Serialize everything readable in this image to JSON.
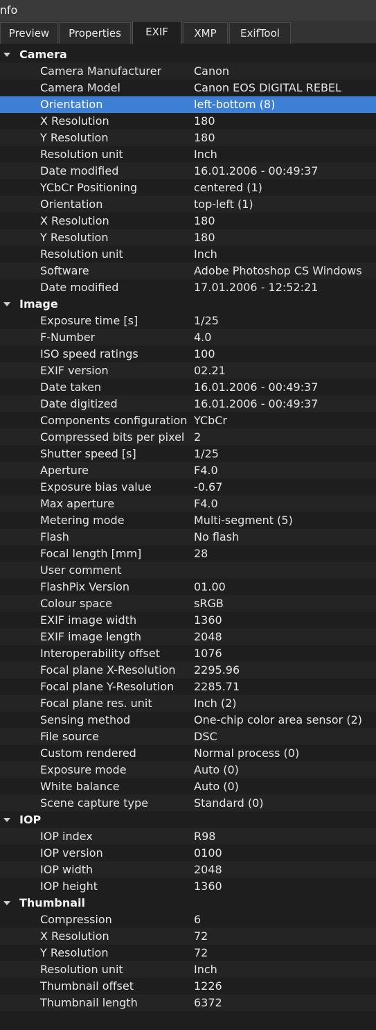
{
  "window": {
    "title": "Info"
  },
  "tabs": [
    {
      "label": "Preview",
      "active": false
    },
    {
      "label": "Properties",
      "active": false
    },
    {
      "label": "EXIF",
      "active": true
    },
    {
      "label": "XMP",
      "active": false
    },
    {
      "label": "ExifTool",
      "active": false
    }
  ],
  "groups": [
    {
      "name": "Camera",
      "rows": [
        {
          "label": "Camera Manufacturer",
          "value": "Canon"
        },
        {
          "label": "Camera Model",
          "value": "Canon EOS DIGITAL REBEL"
        },
        {
          "label": "Orientation",
          "value": "left-bottom (8)",
          "selected": true
        },
        {
          "label": "X Resolution",
          "value": "180"
        },
        {
          "label": "Y Resolution",
          "value": "180"
        },
        {
          "label": "Resolution unit",
          "value": "Inch"
        },
        {
          "label": "Date modified",
          "value": "16.01.2006 - 00:49:37"
        },
        {
          "label": "YCbCr Positioning",
          "value": "centered (1)"
        },
        {
          "label": "Orientation",
          "value": "top-left (1)"
        },
        {
          "label": "X Resolution",
          "value": "180"
        },
        {
          "label": "Y Resolution",
          "value": "180"
        },
        {
          "label": "Resolution unit",
          "value": "Inch"
        },
        {
          "label": "Software",
          "value": "Adobe Photoshop CS Windows"
        },
        {
          "label": "Date modified",
          "value": "17.01.2006 - 12:52:21"
        }
      ]
    },
    {
      "name": "Image",
      "rows": [
        {
          "label": "Exposure time [s]",
          "value": "1/25"
        },
        {
          "label": "F-Number",
          "value": "4.0"
        },
        {
          "label": "ISO speed ratings",
          "value": "100"
        },
        {
          "label": "EXIF version",
          "value": "02.21"
        },
        {
          "label": "Date taken",
          "value": "16.01.2006 - 00:49:37"
        },
        {
          "label": "Date digitized",
          "value": "16.01.2006 - 00:49:37"
        },
        {
          "label": "Components configuration",
          "value": "YCbCr"
        },
        {
          "label": "Compressed bits per pixel",
          "value": "2"
        },
        {
          "label": "Shutter speed [s]",
          "value": "1/25"
        },
        {
          "label": "Aperture",
          "value": "F4.0"
        },
        {
          "label": "Exposure bias value",
          "value": "-0.67"
        },
        {
          "label": "Max aperture",
          "value": "F4.0"
        },
        {
          "label": "Metering mode",
          "value": "Multi-segment (5)"
        },
        {
          "label": "Flash",
          "value": "No flash"
        },
        {
          "label": "Focal length [mm]",
          "value": "28"
        },
        {
          "label": "User comment",
          "value": ""
        },
        {
          "label": "FlashPix Version",
          "value": "01.00"
        },
        {
          "label": "Colour space",
          "value": "sRGB"
        },
        {
          "label": "EXIF image width",
          "value": "1360"
        },
        {
          "label": "EXIF image length",
          "value": "2048"
        },
        {
          "label": "Interoperability offset",
          "value": "1076"
        },
        {
          "label": "Focal plane X-Resolution",
          "value": "2295.96"
        },
        {
          "label": "Focal plane Y-Resolution",
          "value": "2285.71"
        },
        {
          "label": "Focal plane res. unit",
          "value": "Inch (2)"
        },
        {
          "label": "Sensing method",
          "value": "One-chip color area sensor (2)"
        },
        {
          "label": "File source",
          "value": "DSC"
        },
        {
          "label": "Custom rendered",
          "value": "Normal process (0)"
        },
        {
          "label": "Exposure mode",
          "value": "Auto (0)"
        },
        {
          "label": "White balance",
          "value": "Auto (0)"
        },
        {
          "label": "Scene capture type",
          "value": "Standard (0)"
        }
      ]
    },
    {
      "name": "IOP",
      "rows": [
        {
          "label": "IOP index",
          "value": "R98"
        },
        {
          "label": "IOP version",
          "value": "0100"
        },
        {
          "label": "IOP width",
          "value": "2048"
        },
        {
          "label": "IOP height",
          "value": "1360"
        }
      ]
    },
    {
      "name": "Thumbnail",
      "rows": [
        {
          "label": "Compression",
          "value": "6"
        },
        {
          "label": "X Resolution",
          "value": "72"
        },
        {
          "label": "Y Resolution",
          "value": "72"
        },
        {
          "label": "Resolution unit",
          "value": "Inch"
        },
        {
          "label": "Thumbnail offset",
          "value": "1226"
        },
        {
          "label": "Thumbnail length",
          "value": "6372"
        }
      ]
    }
  ],
  "colors": {
    "background": "#1e1e1e",
    "row_alt": "#242424",
    "selection": "#3d7fd4",
    "text": "#e6e6e6"
  }
}
